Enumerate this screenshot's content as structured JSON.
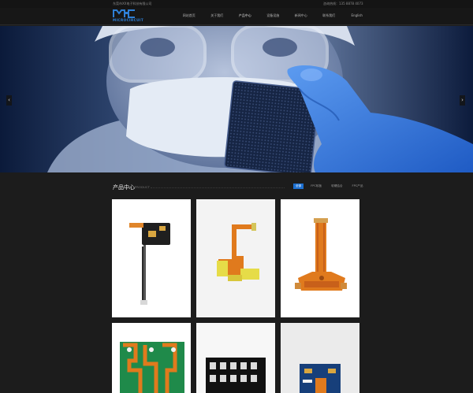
{
  "topbar": {
    "company": "东莞市XX电子科技有限公司",
    "hotline": "咨询热线：135 8878 4073"
  },
  "header": {
    "logo_text": "MICROCIRCUIT",
    "nav": [
      "网站首页",
      "关于我们",
      "产品中心",
      "设备设施",
      "新闻中心",
      "联系我们",
      "English"
    ]
  },
  "banner": {
    "prev_label": "‹",
    "next_label": "›"
  },
  "products": {
    "title": "产品中心",
    "subtitle": "PRODUCT",
    "tabs": [
      "全部",
      "FPC软板",
      "软硬结合",
      "FPC产品"
    ]
  },
  "colors": {
    "accent": "#1c6fd0",
    "background": "#1c1c1c",
    "fpc_orange": "#e07a1d",
    "glove_blue": "#3d7de0"
  }
}
